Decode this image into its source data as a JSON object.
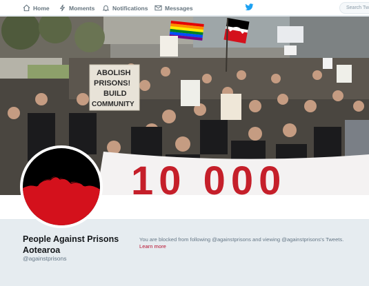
{
  "nav": {
    "home": "Home",
    "moments": "Moments",
    "notifications": "Notifications",
    "messages": "Messages",
    "search_placeholder": "Search Twitter"
  },
  "icons": {
    "home": "home-icon",
    "moments": "lightning-icon",
    "notifications": "bell-icon",
    "messages": "envelope-icon",
    "logo": "twitter-bird-icon"
  },
  "banner": {
    "placard_lines": [
      "ABOLISH",
      "PRISONS!",
      "BUILD",
      "COMMUNITY"
    ],
    "big_banner_text": "10 000"
  },
  "profile": {
    "name": "People Against Prisons Aotearoa",
    "handle": "@againstprisons",
    "blocked_message": "You are blocked from following @againstprisons and viewing @againstprisons's Tweets.",
    "learn_more": "Learn more"
  },
  "colors": {
    "twitter_blue": "#1da1f2",
    "link_red": "#b8102f",
    "avatar_red": "#d4111c",
    "avatar_black": "#000000"
  }
}
